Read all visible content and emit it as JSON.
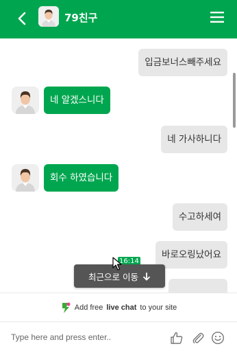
{
  "header": {
    "title": "79친구"
  },
  "messages": [
    {
      "side": "out",
      "text": "입금보너스빼주세요"
    },
    {
      "side": "in",
      "text": "네 알겠스니다"
    },
    {
      "side": "out",
      "text": "네 가사하니다"
    },
    {
      "side": "in",
      "text": "회수 하였습니다"
    },
    {
      "side": "out",
      "text": "수고하세여"
    },
    {
      "side": "out",
      "text": "바로오링났어요"
    }
  ],
  "time_badge": "16:14",
  "recent_button": {
    "label": "최근으로 이동"
  },
  "promo": {
    "prefix": "Add free",
    "bold": "live chat",
    "suffix": "to your site"
  },
  "composer": {
    "placeholder": "Type here and press enter.."
  },
  "icons": {
    "back": "chevron-left-icon",
    "menu": "hamburger-menu-icon",
    "thumbs_up": "thumbs-up-icon",
    "attach": "paperclip-icon",
    "emoji": "smiley-icon",
    "arrow_down": "arrow-down-icon"
  },
  "colors": {
    "brand": "#00a64f",
    "out_bubble": "#e7e7e7",
    "recent_button": "#555555"
  }
}
